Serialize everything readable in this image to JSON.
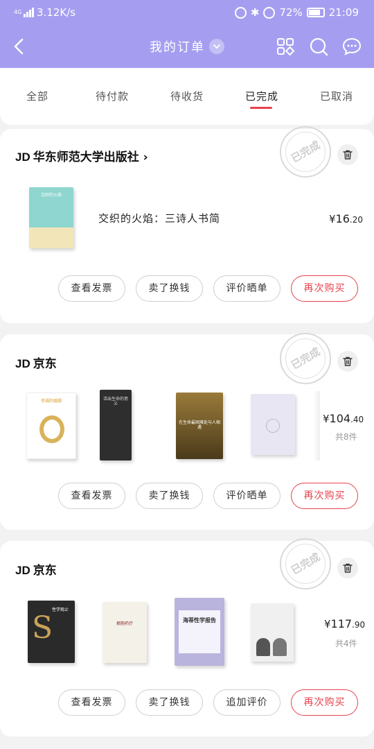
{
  "status_bar": {
    "network": "4G",
    "speed": "3.12K/s",
    "battery": "72%",
    "time": "21:09"
  },
  "header": {
    "title": "我的订单",
    "icons": [
      "back-icon",
      "scan-grid-icon",
      "search-icon",
      "message-icon"
    ]
  },
  "tabs": [
    {
      "label": "全部"
    },
    {
      "label": "待付款"
    },
    {
      "label": "待收货"
    },
    {
      "label": "已完成",
      "active": true
    },
    {
      "label": "已取消"
    }
  ],
  "orders": [
    {
      "shop_prefix": "JD",
      "shop": "华东师范大学出版社",
      "shop_arrow": "›",
      "stamp": "已完成",
      "product_name": "交织的火焰：三诗人书简",
      "price_symbol": "¥",
      "price_int": "16",
      "price_dec": ".20",
      "book_text": "交织的火焰",
      "buttons": [
        "查看发票",
        "卖了换钱",
        "评价晒单",
        "再次购买"
      ]
    },
    {
      "shop_prefix": "JD",
      "shop": "京东",
      "stamp": "已完成",
      "price_symbol": "¥",
      "price_int": "104",
      "price_dec": ".40",
      "count": "共8件",
      "book_texts": [
        "幸福的婚姻",
        "活出生命的意义",
        "在生命最困难处与人相遇",
        ""
      ],
      "buttons": [
        "查看发票",
        "卖了换钱",
        "评价晒单",
        "再次购买"
      ]
    },
    {
      "shop_prefix": "JD",
      "shop": "京东",
      "stamp": "已完成",
      "price_symbol": "¥",
      "price_int": "117",
      "price_dec": ".90",
      "count": "共4件",
      "book_texts": [
        "性学观止",
        "拥抱药疗",
        "海蒂性学报告",
        ""
      ],
      "buttons": [
        "查看发票",
        "卖了换钱",
        "追加评价",
        "再次购买"
      ]
    }
  ],
  "colors": {
    "header_bg": "#a59ef0",
    "accent_red": "#e8414d"
  }
}
